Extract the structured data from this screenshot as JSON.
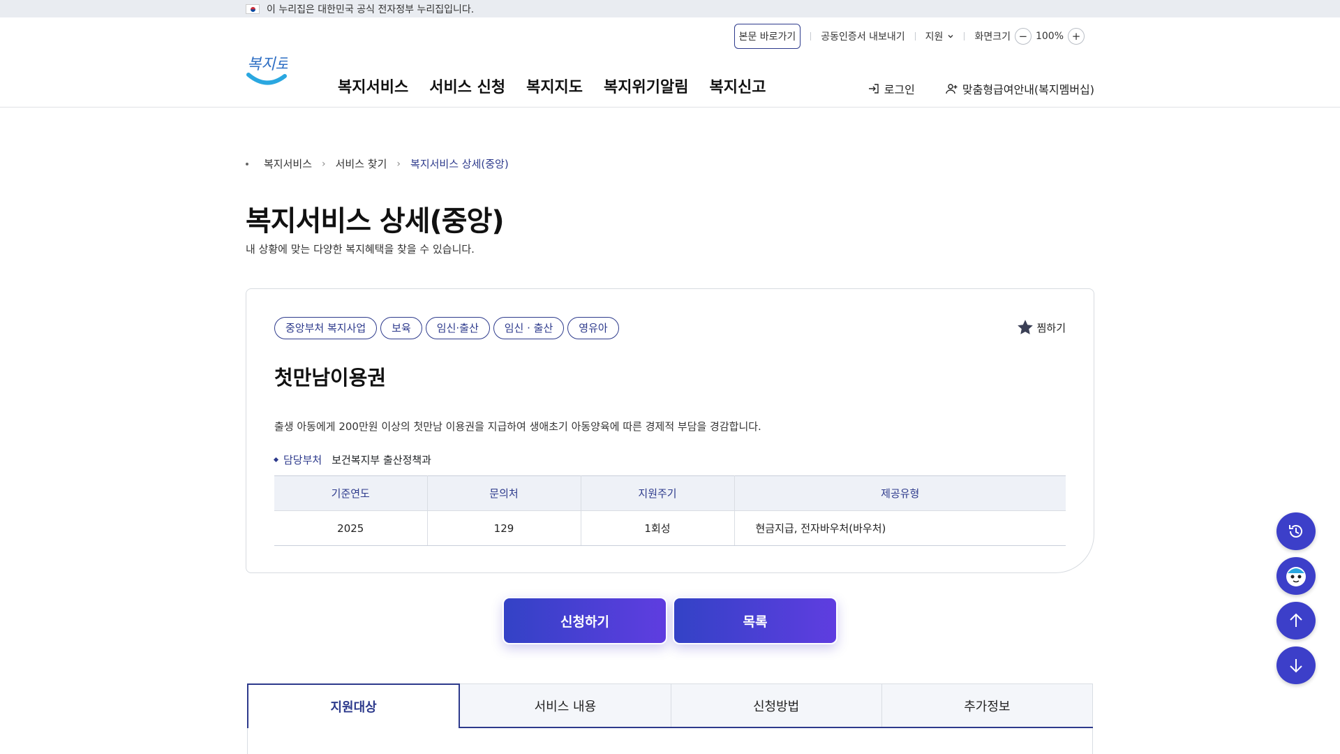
{
  "gov_banner": {
    "text": "이 누리집은 대한민국 공식 전자정부 누리집입니다."
  },
  "utility": {
    "skip_link": "본문 바로가기",
    "cert_export": "공동인증서 내보내기",
    "support": "지원",
    "zoom_label": "화면크기",
    "zoom_value": "100%"
  },
  "logo": {
    "text": "복지로"
  },
  "gnb": [
    "복지서비스",
    "서비스 신청",
    "복지지도",
    "복지위기알림",
    "복지신고"
  ],
  "header_right": {
    "login": "로그인",
    "membership": "맞춤형급여안내(복지멤버십)"
  },
  "breadcrumb": [
    "복지서비스",
    "서비스 찾기",
    "복지서비스 상세(중앙)"
  ],
  "page": {
    "title": "복지서비스 상세(중앙)",
    "description": "내 상황에 맞는 다양한 복지혜택을 찾을 수 있습니다."
  },
  "service": {
    "tags": [
      "중앙부처 복지사업",
      "보육",
      "임신·출산",
      "임신 · 출산",
      "영유아"
    ],
    "favorite": "찜하기",
    "title": "첫만남이용권",
    "description": "출생 아동에게 200만원 이상의 첫만남 이용권을 지급하여 생애초기 아동양육에 따른 경제적 부담을 경감합니다.",
    "dept_label": "담당부처",
    "dept_value": "보건복지부 출산정책과",
    "table_headers": [
      "기준연도",
      "문의처",
      "지원주기",
      "제공유형"
    ],
    "table_values": [
      "2025",
      "129",
      "1회성",
      "현금지급, 전자바우처(바우처)"
    ]
  },
  "buttons": {
    "apply": "신청하기",
    "list": "목록"
  },
  "tabs": [
    "지원대상",
    "서비스 내용",
    "신청방법",
    "추가정보"
  ],
  "colors": {
    "primary": "#2d3a8c",
    "button_gradient_start": "#3342c6",
    "button_gradient_end": "#5f3de0",
    "floating": "#3c3fc9"
  },
  "floating_icons": [
    "history-icon",
    "chatbot-icon",
    "arrow-up-icon",
    "arrow-down-icon"
  ]
}
